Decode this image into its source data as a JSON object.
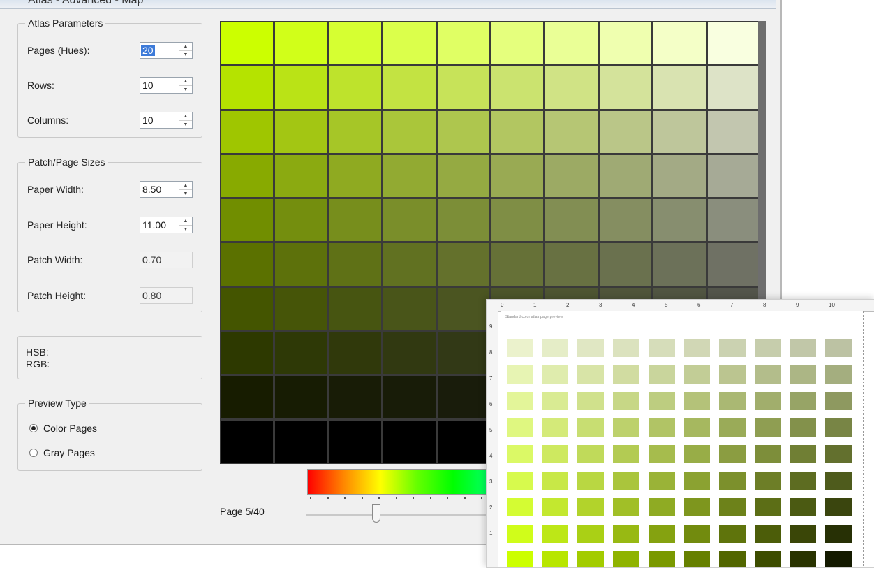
{
  "window": {
    "title": "Atlas - Advanced - Map"
  },
  "atlas_parameters": {
    "title": "Atlas Parameters",
    "pages_label": "Pages (Hues):",
    "pages_value": "20",
    "rows_label": "Rows:",
    "rows_value": "10",
    "columns_label": "Columns:",
    "columns_value": "10"
  },
  "sizes": {
    "title": "Patch/Page Sizes",
    "paper_width_label": "Paper Width:",
    "paper_width_value": "8.50",
    "paper_height_label": "Paper Height:",
    "paper_height_value": "11.00",
    "patch_width_label": "Patch Width:",
    "patch_width_value": "0.70",
    "patch_height_label": "Patch Height:",
    "patch_height_value": "0.80"
  },
  "color_info": {
    "hsb_label": "HSB:",
    "rgb_label": "RGB:"
  },
  "preview_type": {
    "title": "Preview Type",
    "options": [
      {
        "label": "Color Pages",
        "selected": true
      },
      {
        "label": "Gray Pages",
        "selected": false
      }
    ]
  },
  "page_indicator": "Page 5/40",
  "page_slider": {
    "position": 0.38
  },
  "preview": {
    "hue": "#ccff00",
    "rows": 10,
    "columns": 10
  },
  "print_preview": {
    "caption": "Standard color atlas page preview",
    "top_ruler": [
      "0",
      "1",
      "2",
      "3",
      "4",
      "5",
      "6",
      "7",
      "8",
      "9",
      "10"
    ],
    "left_ruler": [
      "9",
      "8",
      "7",
      "6",
      "5",
      "4",
      "3",
      "2",
      "1"
    ]
  }
}
